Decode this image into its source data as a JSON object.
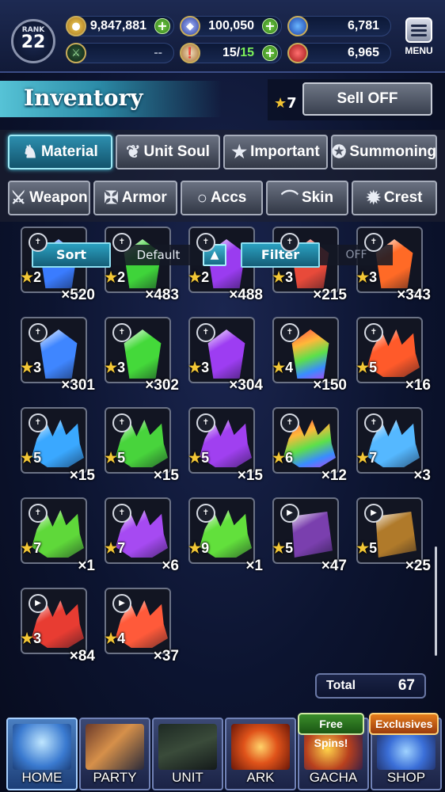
{
  "topbar": {
    "rank_label": "RANK",
    "rank_value": "22",
    "gold": "9,847,881",
    "crystals": "100,050",
    "blue_orbs": "6,781",
    "guild_value": "--",
    "stamina_current": "15",
    "stamina_max": "15",
    "red_orbs": "6,965",
    "menu_label": "MENU",
    "icons": [
      "gold-coin-icon",
      "crystal-icon",
      "blue-orb-icon",
      "guild-icon",
      "stamina-icon",
      "red-orb-icon"
    ]
  },
  "header": {
    "title": "Inventory",
    "sell_star": "7",
    "sell_button": "Sell OFF"
  },
  "tabs_row1": [
    {
      "label": "Material",
      "icon": "material-bag-icon",
      "active": true
    },
    {
      "label": "Unit Soul",
      "icon": "unit-soul-icon",
      "active": false
    },
    {
      "label": "Important",
      "icon": "star-icon",
      "active": false
    },
    {
      "label": "Summoning",
      "icon": "summoning-icon",
      "active": false
    }
  ],
  "tabs_row2": [
    {
      "label": "Weapon",
      "icon": "sword-icon"
    },
    {
      "label": "Armor",
      "icon": "armor-icon"
    },
    {
      "label": "Accs",
      "icon": "ring-icon"
    },
    {
      "label": "Skin",
      "icon": "hanger-icon"
    },
    {
      "label": "Crest",
      "icon": "crest-icon"
    }
  ],
  "sort": {
    "sort_label": "Sort",
    "sort_value": "Default",
    "filter_label": "Filter",
    "filter_value": "OFF"
  },
  "items": [
    {
      "stars": "2",
      "qty": "×520",
      "kind": "crystal",
      "color": "#3a7cff",
      "tag": "awaken"
    },
    {
      "stars": "2",
      "qty": "×483",
      "kind": "crystal",
      "color": "#3fd43a",
      "tag": "awaken"
    },
    {
      "stars": "2",
      "qty": "×488",
      "kind": "crystal",
      "color": "#9a3cf0",
      "tag": "awaken"
    },
    {
      "stars": "3",
      "qty": "×215",
      "kind": "crystal",
      "color": "#e84a3a",
      "tag": "awaken"
    },
    {
      "stars": "3",
      "qty": "×343",
      "kind": "crystal",
      "color": "#ff6a26",
      "tag": "awaken"
    },
    {
      "stars": "3",
      "qty": "×301",
      "kind": "crystal",
      "color": "#3f86ff",
      "tag": "awaken"
    },
    {
      "stars": "3",
      "qty": "×302",
      "kind": "crystal",
      "color": "#44d93a",
      "tag": "awaken"
    },
    {
      "stars": "3",
      "qty": "×304",
      "kind": "crystal",
      "color": "#9d3df2",
      "tag": "awaken"
    },
    {
      "stars": "4",
      "qty": "×150",
      "kind": "crystal",
      "color": "rainbow",
      "tag": "awaken"
    },
    {
      "stars": "5",
      "qty": "×16",
      "kind": "cluster",
      "color": "#ff5a2a",
      "tag": "awaken"
    },
    {
      "stars": "5",
      "qty": "×15",
      "kind": "cluster",
      "color": "#3aa8ff",
      "tag": "awaken"
    },
    {
      "stars": "5",
      "qty": "×15",
      "kind": "cluster",
      "color": "#48d43c",
      "tag": "awaken"
    },
    {
      "stars": "5",
      "qty": "×15",
      "kind": "cluster",
      "color": "#a040f0",
      "tag": "awaken"
    },
    {
      "stars": "6",
      "qty": "×12",
      "kind": "cluster",
      "color": "rainbow",
      "tag": "awaken"
    },
    {
      "stars": "7",
      "qty": "×3",
      "kind": "cluster",
      "color": "#55b8ff",
      "tag": "awaken"
    },
    {
      "stars": "7",
      "qty": "×1",
      "kind": "cluster",
      "color": "#5fd83a",
      "tag": "awaken"
    },
    {
      "stars": "7",
      "qty": "×6",
      "kind": "cluster",
      "color": "#a64af2",
      "tag": "awaken"
    },
    {
      "stars": "9",
      "qty": "×1",
      "kind": "cluster",
      "color": "#62e03c",
      "tag": "awaken"
    },
    {
      "stars": "5",
      "qty": "×47",
      "kind": "book",
      "color": "#7a3fae",
      "tag": "skill"
    },
    {
      "stars": "5",
      "qty": "×25",
      "kind": "book",
      "color": "#b07a2a",
      "tag": "skill"
    },
    {
      "stars": "3",
      "qty": "×84",
      "kind": "cluster",
      "color": "#e83c32",
      "tag": "skill"
    },
    {
      "stars": "4",
      "qty": "×37",
      "kind": "cluster",
      "color": "#ff5a3a",
      "tag": "skill"
    }
  ],
  "total": {
    "label": "Total",
    "value": "67"
  },
  "nav": [
    {
      "label": "HOME",
      "name": "home"
    },
    {
      "label": "PARTY",
      "name": "party"
    },
    {
      "label": "UNIT",
      "name": "unit"
    },
    {
      "label": "ARK",
      "name": "ark"
    },
    {
      "label": "GACHA",
      "name": "gacha"
    },
    {
      "label": "SHOP",
      "name": "shop"
    }
  ],
  "badges": {
    "free_spins": "Free Spins!",
    "exclusives": "Exclusives"
  }
}
